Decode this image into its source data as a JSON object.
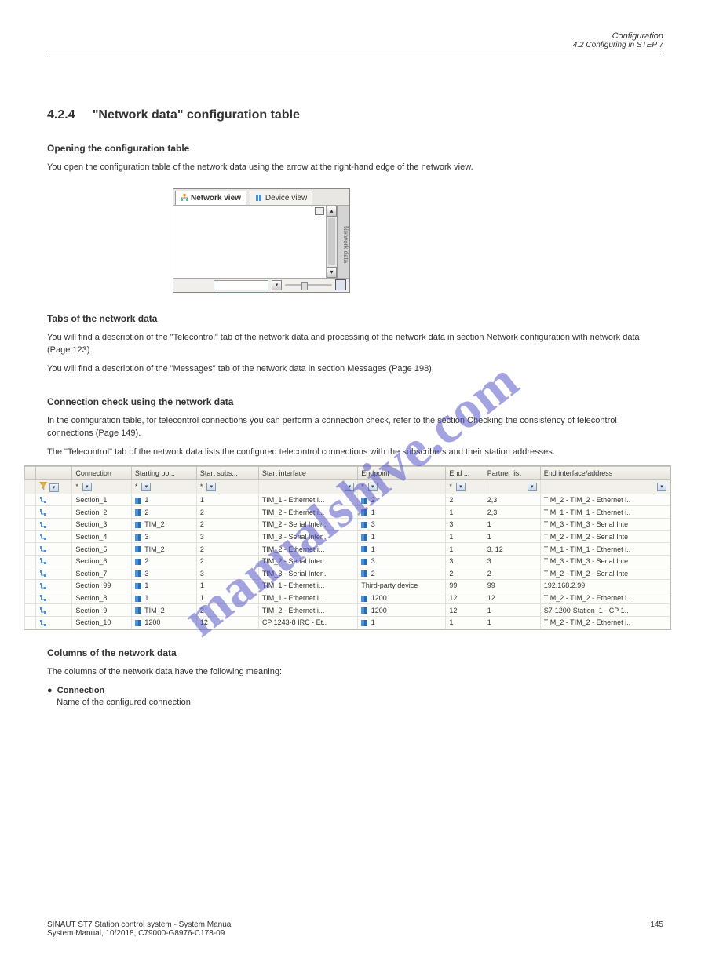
{
  "header": {
    "title": "Configuration",
    "subtitle": "4.2 Configuring in STEP 7"
  },
  "section_num": "4.2.4",
  "section_title": "\"Network data\" configuration table",
  "opening_heading": "Opening the configuration table",
  "opening_para1": "You open the configuration table of the network data using the arrow at the right-hand edge of the network view.",
  "img1": {
    "tabs": {
      "network": "Network view",
      "device": "Device view"
    },
    "sidebar": "Network data"
  },
  "tabs_heading": "Tabs of the network data",
  "tabs_para1": "You will find a description of the \"Telecontrol\" tab of the network data and processing of the network data in section Network configuration with network data (Page 123).",
  "tabs_para2": "You will find a description of the \"Messages\" tab of the network data in section Messages (Page 198).",
  "conn_heading": "Connection check using the network data",
  "conn_para1": "In the configuration table, for telecontrol connections you can perform a connection check, refer to the section Checking the consistency of telecontrol connections (Page 149).",
  "conn_para2": "The \"Telecontrol\" tab of the network data lists the configured telecontrol connections with the subscribers and their station addresses.",
  "table": {
    "columns": [
      "",
      "",
      "Connection",
      "Starting po...",
      "Start subs...",
      "Start interface",
      "Endpoint",
      "End ...",
      "Partner list",
      "End interface/address"
    ],
    "filter": [
      "",
      "funnel",
      "*",
      "*",
      "*",
      "",
      "*",
      "*",
      "",
      ""
    ],
    "rows": [
      {
        "c": "Section_1",
        "sp": "1",
        "ss": "1",
        "si": "TIM_1 - Ethernet i...",
        "ep": "2",
        "es": "2",
        "pl": "2,3",
        "ei": "TIM_2 - TIM_2 - Ethernet i.."
      },
      {
        "c": "Section_2",
        "sp": "2",
        "ss": "2",
        "si": "TIM_2 - Ethernet i...",
        "ep": "1",
        "es": "1",
        "pl": "2,3",
        "ei": "TIM_1 - TIM_1 - Ethernet i.."
      },
      {
        "c": "Section_3",
        "sp": "TIM_2",
        "ss": "2",
        "si": "TIM_2 - Serial Inter..",
        "ep": "3",
        "es": "3",
        "pl": "1",
        "ei": "TIM_3 - TIM_3 - Serial Inte"
      },
      {
        "c": "Section_4",
        "sp": "3",
        "ss": "3",
        "si": "TIM_3 - Serial Inter..",
        "ep": "1",
        "es": "1",
        "pl": "1",
        "ei": "TIM_2 - TIM_2 - Serial Inte"
      },
      {
        "c": "Section_5",
        "sp": "TIM_2",
        "ss": "2",
        "si": "TIM_2 - Ethernet i...",
        "ep": "1",
        "es": "1",
        "pl": "3, 12",
        "ei": "TIM_1 - TIM_1 - Ethernet i.."
      },
      {
        "c": "Section_6",
        "sp": "2",
        "ss": "2",
        "si": "TIM_2 - Serial Inter..",
        "ep": "3",
        "es": "3",
        "pl": "3",
        "ei": "TIM_3 - TIM_3 - Serial Inte"
      },
      {
        "c": "Section_7",
        "sp": "3",
        "ss": "3",
        "si": "TIM_3 - Serial Inter..",
        "ep": "2",
        "es": "2",
        "pl": "2",
        "ei": "TIM_2 - TIM_2 - Serial Inte"
      },
      {
        "c": "Section_99",
        "sp": "1",
        "ss": "1",
        "si": "TIM_1 - Ethernet i...",
        "ep": "Third-party device",
        "es": "99",
        "pl": "99",
        "ei": "192.168.2.99",
        "noEpIcon": true
      },
      {
        "c": "Section_8",
        "sp": "1",
        "ss": "1",
        "si": "TIM_1 - Ethernet i...",
        "ep": "1200",
        "es": "12",
        "pl": "12",
        "ei": "TIM_2 - TIM_2 - Ethernet i.."
      },
      {
        "c": "Section_9",
        "sp": "TIM_2",
        "ss": "2",
        "si": "TIM_2 - Ethernet i...",
        "ep": "1200",
        "es": "12",
        "pl": "1",
        "ei": "S7-1200-Station_1 - CP 1.."
      },
      {
        "c": "Section_10",
        "sp": "1200",
        "ss": "12",
        "si": "CP 1243-8 IRC - Et..",
        "ep": "1",
        "es": "1",
        "pl": "1",
        "ei": "TIM_2 - TIM_2 - Ethernet i.."
      }
    ]
  },
  "col_heading": "Columns of the network data",
  "col_para": "The columns of the network data have the following meaning:",
  "col_bullet1_label": "Connection",
  "col_bullet1_text": "Name of the configured connection",
  "footer": {
    "left_line1": "SINAUT ST7 Station control system - System Manual",
    "left_line2": "System Manual, 10/2018, C79000-G8976-C178-09",
    "page": "145"
  },
  "watermark": "manualshive.com"
}
